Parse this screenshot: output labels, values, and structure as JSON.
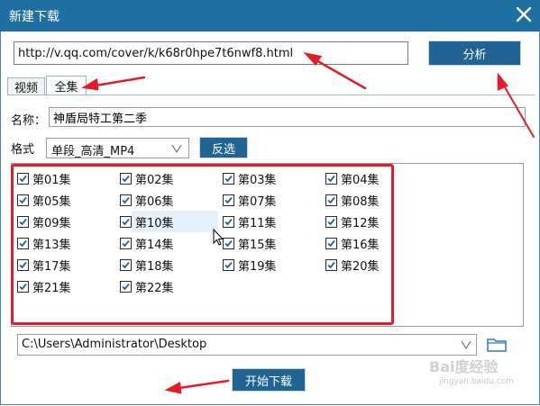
{
  "window": {
    "title": "新建下载",
    "close_icon": "close-icon",
    "title_bar_color": "#1f6fa3"
  },
  "url": {
    "value": "http://v.qq.com/cover/k/k68r0hpe7t6nwf8.html",
    "analyze_label": "分析"
  },
  "tabs": [
    {
      "label": "视频",
      "active": false
    },
    {
      "label": "全集",
      "active": true
    }
  ],
  "name": {
    "label": "名称：",
    "value": "神盾局特工第二季"
  },
  "format": {
    "label": "格式",
    "selected": "单段_高清_MP4",
    "invert_label": "反选"
  },
  "episodes": [
    {
      "label": "第01集",
      "checked": true
    },
    {
      "label": "第02集",
      "checked": true
    },
    {
      "label": "第03集",
      "checked": true
    },
    {
      "label": "第04集",
      "checked": true
    },
    {
      "label": "第05集",
      "checked": true
    },
    {
      "label": "第06集",
      "checked": true
    },
    {
      "label": "第07集",
      "checked": true
    },
    {
      "label": "第08集",
      "checked": true
    },
    {
      "label": "第09集",
      "checked": true
    },
    {
      "label": "第10集",
      "checked": true
    },
    {
      "label": "第11集",
      "checked": true
    },
    {
      "label": "第12集",
      "checked": true
    },
    {
      "label": "第13集",
      "checked": true
    },
    {
      "label": "第14集",
      "checked": true
    },
    {
      "label": "第15集",
      "checked": true
    },
    {
      "label": "第16集",
      "checked": true
    },
    {
      "label": "第17集",
      "checked": true
    },
    {
      "label": "第18集",
      "checked": true
    },
    {
      "label": "第19集",
      "checked": true
    },
    {
      "label": "第20集",
      "checked": true
    },
    {
      "label": "第21集",
      "checked": true
    },
    {
      "label": "第22集",
      "checked": true
    }
  ],
  "save_path": {
    "value": "C:\\Users\\Administrator\\Desktop",
    "folder_icon": "folder-icon"
  },
  "start_label": "开始下载",
  "watermark": {
    "brand": "Bai度经验",
    "url": "jingyan.baidu.com"
  },
  "colors": {
    "button_bg": "#1f6492",
    "highlight_red": "#d9202e",
    "hover_row": "#e5f1fa"
  }
}
